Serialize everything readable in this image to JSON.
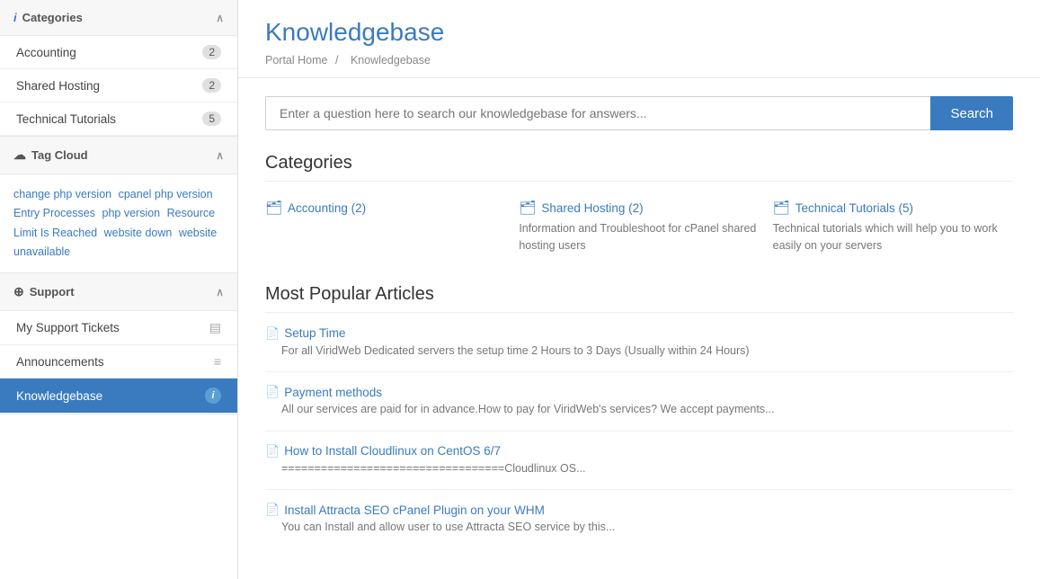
{
  "sidebar": {
    "categories_label": "Categories",
    "categories_icon": "ℹ",
    "chevron": "∧",
    "categories": [
      {
        "label": "Accounting",
        "count": "2"
      },
      {
        "label": "Shared Hosting",
        "count": "2"
      },
      {
        "label": "Technical Tutorials",
        "count": "5"
      }
    ],
    "tagcloud_label": "Tag Cloud",
    "tagcloud_icon": "☁",
    "tags": [
      "change php version",
      "cpanel php version",
      "Entry Processes",
      "php version",
      "Resource Limit Is Reached",
      "website down",
      "website unavailable"
    ],
    "support_label": "Support",
    "support_icon": "⊕",
    "support_items": [
      {
        "label": "My Support Tickets",
        "icon": "▤",
        "active": false
      },
      {
        "label": "Announcements",
        "icon": "≡",
        "active": false
      },
      {
        "label": "Knowledgebase",
        "icon": "ℹ",
        "active": true
      }
    ]
  },
  "main": {
    "title": "Knowledgebase",
    "breadcrumb": {
      "home": "Portal Home",
      "separator": "/",
      "current": "Knowledgebase"
    },
    "search": {
      "placeholder": "Enter a question here to search our knowledgebase for answers...",
      "button_label": "Search"
    },
    "categories_section_title": "Categories",
    "categories": [
      {
        "title": "Accounting (2)",
        "description": ""
      },
      {
        "title": "Shared Hosting (2)",
        "description": "Information and Troubleshoot for cPanel shared hosting users"
      },
      {
        "title": "Technical Tutorials (5)",
        "description": "Technical tutorials which will help you to work easily on your servers"
      }
    ],
    "popular_section_title": "Most Popular Articles",
    "articles": [
      {
        "title": "Setup Time",
        "description": "For all ViridWeb Dedicated servers the setup time 2 Hours to 3 Days (Usually within 24 Hours)"
      },
      {
        "title": "Payment methods",
        "description": "All our services are paid for in advance.How to pay for ViridWeb's services? We accept payments..."
      },
      {
        "title": "How to Install Cloudlinux on CentOS 6/7",
        "description": "==================================Cloudlinux OS..."
      },
      {
        "title": "Install Attracta SEO cPanel Plugin on your WHM",
        "description": "You can Install and allow user to use Attracta SEO service by this..."
      }
    ]
  }
}
